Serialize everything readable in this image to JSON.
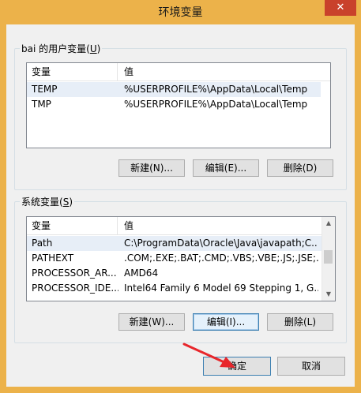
{
  "window": {
    "title": "环境变量",
    "close_glyph": "✕"
  },
  "user_vars": {
    "legend_pre": "bai 的用户变量(",
    "legend_key": "U",
    "legend_post": ")",
    "col_var": "变量",
    "col_val": "值",
    "rows": [
      {
        "name": "TEMP",
        "value": "%USERPROFILE%\\AppData\\Local\\Temp"
      },
      {
        "name": "TMP",
        "value": "%USERPROFILE%\\AppData\\Local\\Temp"
      }
    ],
    "buttons": {
      "new": "新建(N)...",
      "edit": "编辑(E)...",
      "delete": "删除(D)"
    }
  },
  "system_vars": {
    "legend_pre": "系统变量(",
    "legend_key": "S",
    "legend_post": ")",
    "col_var": "变量",
    "col_val": "值",
    "rows": [
      {
        "name": "Path",
        "value": "C:\\ProgramData\\Oracle\\Java\\javapath;C..."
      },
      {
        "name": "PATHEXT",
        "value": ".COM;.EXE;.BAT;.CMD;.VBS;.VBE;.JS;.JSE;..."
      },
      {
        "name": "PROCESSOR_AR...",
        "value": "AMD64"
      },
      {
        "name": "PROCESSOR_IDE...",
        "value": "Intel64 Family 6 Model 69 Stepping 1, G..."
      }
    ],
    "buttons": {
      "new": "新建(W)...",
      "edit": "编辑(I)...",
      "delete": "删除(L)"
    }
  },
  "footer": {
    "ok": "确定",
    "cancel": "取消"
  },
  "colors": {
    "frame": "#ecb24a",
    "close": "#c9412b",
    "arrow": "#e8262b"
  }
}
